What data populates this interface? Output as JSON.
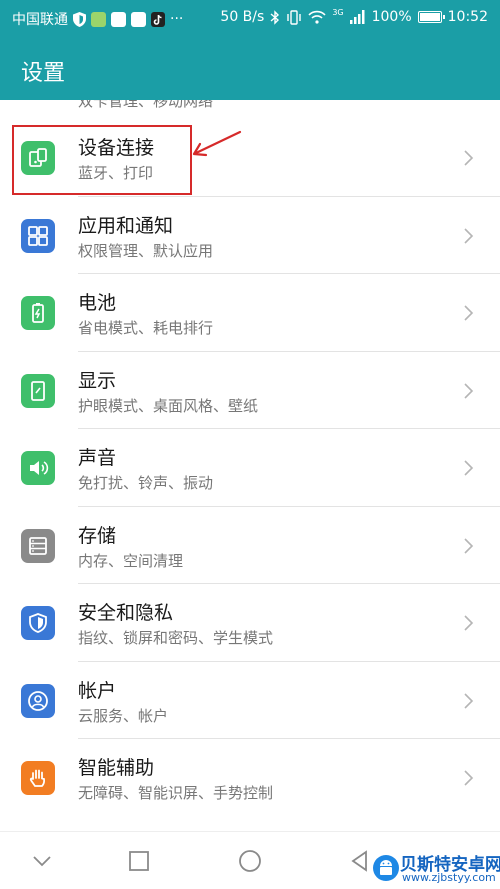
{
  "status_bar": {
    "carrier": "中国联通",
    "more": "···",
    "speed": "50 B/s",
    "network": "3G",
    "battery": "100%",
    "time": "10:52"
  },
  "header": {
    "title": "设置"
  },
  "partial_item": {
    "subtitle": "双卡管理、移动网络"
  },
  "items": [
    {
      "title": "设备连接",
      "subtitle": "蓝牙、打印",
      "icon": "device-connection-icon",
      "color": "#3fbf6b"
    },
    {
      "title": "应用和通知",
      "subtitle": "权限管理、默认应用",
      "icon": "apps-icon",
      "color": "#3a78d6"
    },
    {
      "title": "电池",
      "subtitle": "省电模式、耗电排行",
      "icon": "battery-icon",
      "color": "#3fbf6b"
    },
    {
      "title": "显示",
      "subtitle": "护眼模式、桌面风格、壁纸",
      "icon": "display-icon",
      "color": "#3fbf6b"
    },
    {
      "title": "声音",
      "subtitle": "免打扰、铃声、振动",
      "icon": "sound-icon",
      "color": "#3fbf6b"
    },
    {
      "title": "存储",
      "subtitle": "内存、空间清理",
      "icon": "storage-icon",
      "color": "#8a8a8a"
    },
    {
      "title": "安全和隐私",
      "subtitle": "指纹、锁屏和密码、学生模式",
      "icon": "security-shield-icon",
      "color": "#3a78d6"
    },
    {
      "title": "帐户",
      "subtitle": "云服务、帐户",
      "icon": "account-icon",
      "color": "#3a78d6"
    },
    {
      "title": "智能辅助",
      "subtitle": "无障碍、智能识屏、手势控制",
      "icon": "hand-icon",
      "color": "#f27d22"
    }
  ],
  "colors": {
    "header_bg": "#1b9ea6",
    "highlight": "#d62a2a"
  },
  "watermark": {
    "name": "贝斯特安卓网",
    "url": "www.zjbstyy.com"
  }
}
